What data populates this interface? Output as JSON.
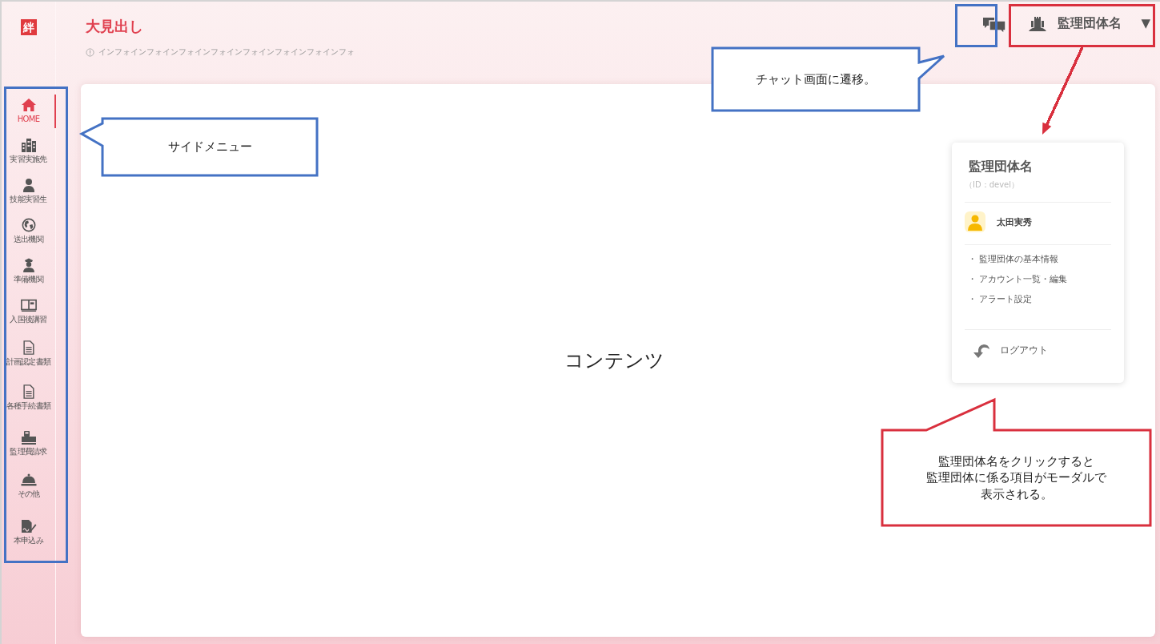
{
  "header": {
    "logo": "絆",
    "title": "大見出し",
    "info": "インフォインフォインフォインフォインフォインフォインフォインフォ"
  },
  "sidebar": {
    "items": [
      {
        "label": "HOME",
        "selected": true
      },
      {
        "label": "実習実施先",
        "selected": false
      },
      {
        "label": "技能実習生",
        "selected": false
      },
      {
        "label": "送出機関",
        "selected": false
      },
      {
        "label": "準備機関",
        "selected": false
      },
      {
        "label": "入国後講習",
        "selected": false
      },
      {
        "label": "計画認定書類",
        "selected": false
      },
      {
        "label": "各種手続書類",
        "selected": false
      },
      {
        "label": "監理費請求",
        "selected": false
      },
      {
        "label": "その他",
        "selected": false
      },
      {
        "label": "本申込み",
        "selected": false
      }
    ]
  },
  "topbar": {
    "org_name": "監理団体名",
    "caret": "▼"
  },
  "content": {
    "text": "コンテンツ"
  },
  "modal": {
    "title": "監理団体名",
    "id": "（ID：devel）",
    "user": "太田実秀",
    "links": [
      "・ 監理団体の基本情報",
      "・ アカウント一覧・編集",
      "・ アラート設定"
    ],
    "logout": "ログアウト"
  },
  "annotations": [
    {
      "kind": "frame",
      "color": "#4472c4"
    },
    {
      "kind": "callout",
      "color": "#4472c4",
      "text": "サイドメニュー"
    },
    {
      "kind": "frame",
      "color": "#4472c4"
    },
    {
      "kind": "callout",
      "color": "#4472c4",
      "text": "チャット画面に遷移。"
    },
    {
      "kind": "frame",
      "color": "#d9303e"
    },
    {
      "kind": "arrow",
      "color": "#d9303e"
    },
    {
      "kind": "callout",
      "color": "#d9303e",
      "lines": [
        "監理団体名をクリックすると",
        "監理団体に係る項目がモーダルで",
        "表示される。"
      ]
    }
  ]
}
